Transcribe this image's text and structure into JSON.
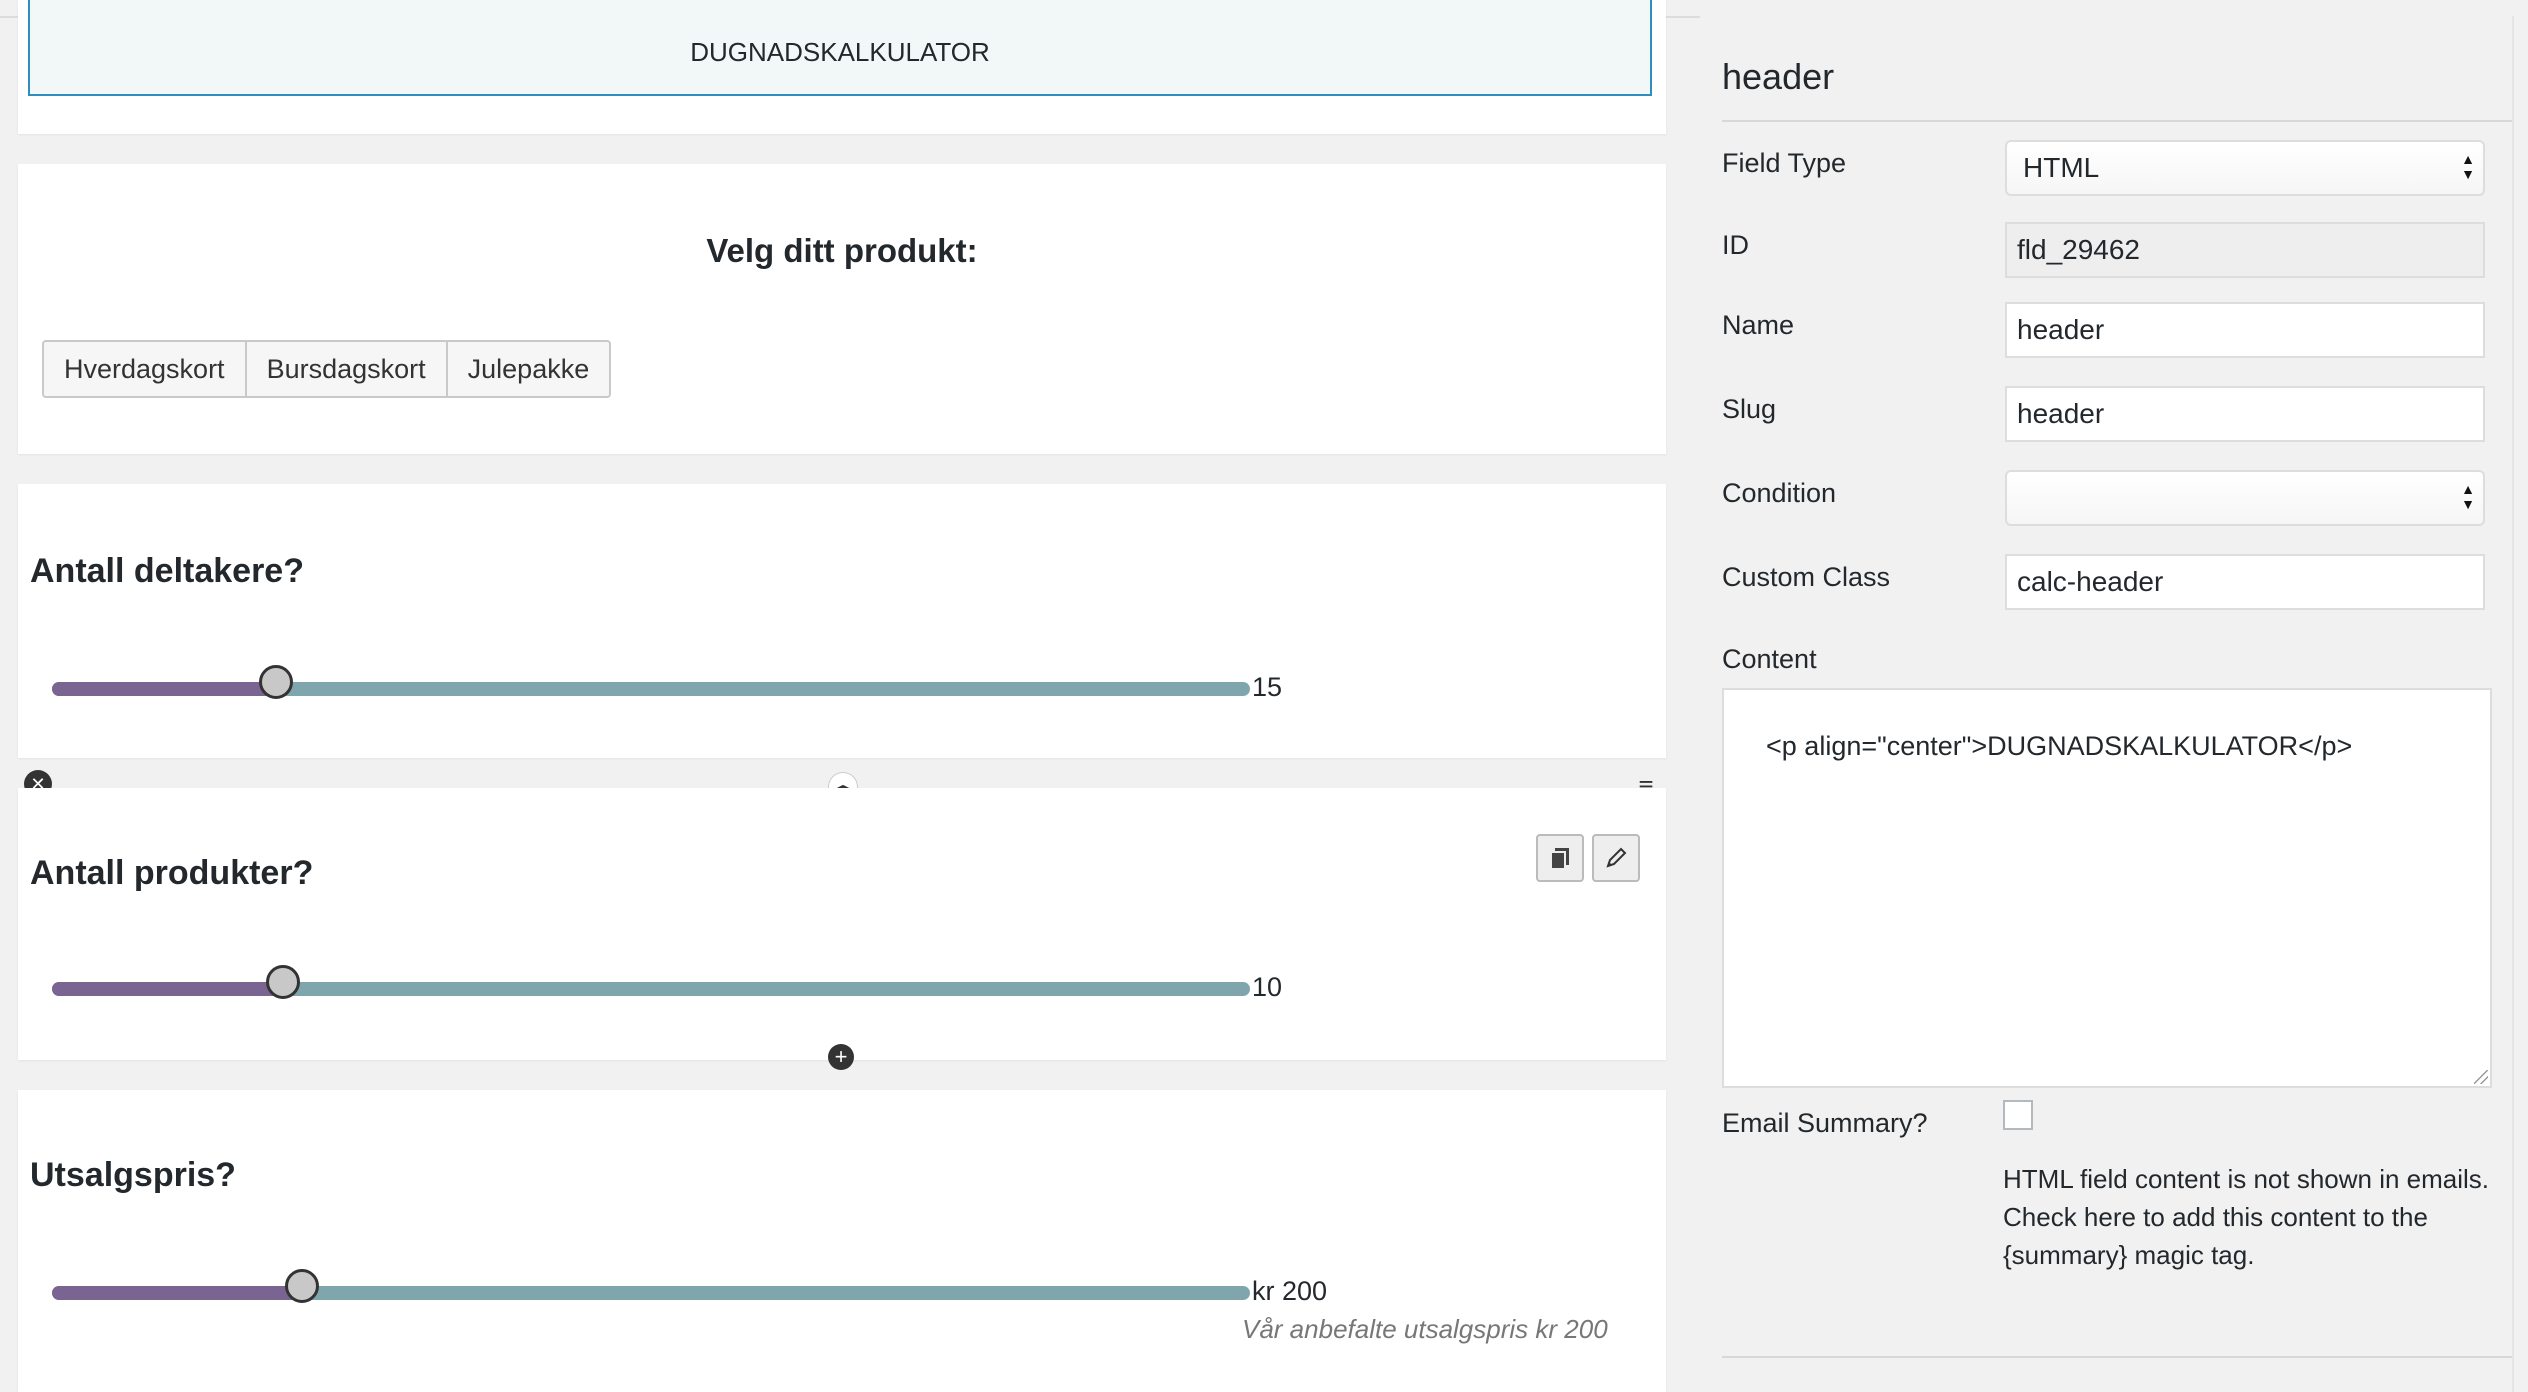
{
  "canvas": {
    "header_preview": "DUGNADSKALKULATOR",
    "product_card": {
      "title": "Velg ditt produkt:",
      "options": [
        "Hverdagskort",
        "Bursdagskort",
        "Julepakke"
      ]
    },
    "sliders": [
      {
        "label": "Antall deltakere?",
        "value_text": "15",
        "fill_fraction": 0.187
      },
      {
        "label": "Antall produkter?",
        "value_text": "10",
        "fill_fraction": 0.193
      },
      {
        "label": "Utsalgspris?",
        "value_text": "kr 200",
        "hint": "Vår anbefalte utsalgspris kr 200",
        "fill_fraction": 0.209
      }
    ]
  },
  "panel": {
    "title": "header",
    "field_type": {
      "label": "Field Type",
      "value": "HTML"
    },
    "id": {
      "label": "ID",
      "value": "fld_29462"
    },
    "name": {
      "label": "Name",
      "value": "header"
    },
    "slug": {
      "label": "Slug",
      "value": "header"
    },
    "condition": {
      "label": "Condition",
      "value": ""
    },
    "custom_class": {
      "label": "Custom Class",
      "value": "calc-header"
    },
    "content": {
      "label": "Content",
      "value": "<p align=\"center\">DUGNADSKALKULATOR</p>"
    },
    "email_summary": {
      "label": "Email Summary?",
      "checked": false,
      "note": "HTML field content is not shown in emails. Check here to add this content to the {summary} magic tag."
    }
  },
  "colors": {
    "slider_fill": "#7a6491",
    "slider_track": "#7fa6ad",
    "selected_border": "#2f8dc0",
    "active_tab": "#2e6da4"
  },
  "icons": [
    "close-icon",
    "resize-horizontal-icon",
    "menu-icon",
    "duplicate-icon",
    "pencil-icon",
    "add-icon",
    "select-arrows-icon"
  ]
}
